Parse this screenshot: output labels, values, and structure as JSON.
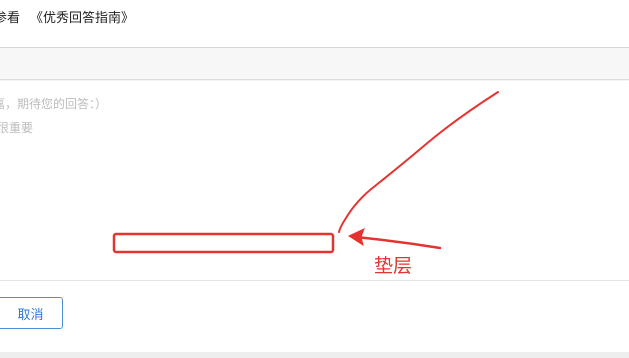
{
  "guide": {
    "prefix": "参看",
    "link": "《优秀回答指南》"
  },
  "editor": {
    "placeholder_line1": "嘉，期待您的回答：）",
    "placeholder_line2": "很重要"
  },
  "actions": {
    "cancel_label": "取消"
  },
  "annotation": {
    "label": "垫层",
    "color": "#e53330"
  }
}
